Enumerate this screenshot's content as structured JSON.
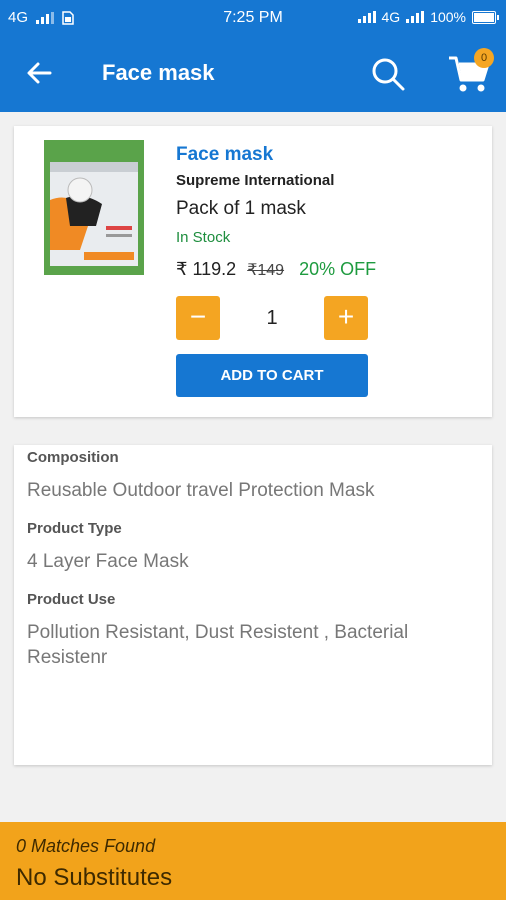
{
  "status_bar": {
    "network_left": "4G",
    "time": "7:25 PM",
    "network_right": "4G",
    "battery": "100%"
  },
  "app_bar": {
    "title": "Face mask",
    "cart_count": "0",
    "back_icon": "arrow-left-icon",
    "search_icon": "search-icon",
    "cart_icon": "cart-icon"
  },
  "product": {
    "name": "Face mask",
    "manufacturer": "Supreme International",
    "pack": "Pack of 1 mask",
    "stock": "In Stock",
    "price": "₹ 119.2",
    "mrp": "₹149",
    "discount": "20% OFF",
    "quantity": "1",
    "minus": "−",
    "plus": "+",
    "add_to_cart": "ADD TO CART"
  },
  "details": [
    {
      "label": "Composition",
      "value": "Reusable Outdoor travel Protection Mask"
    },
    {
      "label": "Product Type",
      "value": "4 Layer Face Mask"
    },
    {
      "label": "Product Use",
      "value": "Pollution Resistant, Dust Resistent , Bacterial Resistenr"
    }
  ],
  "substitutes": {
    "matches": "0 Matches Found",
    "status": "No Substitutes"
  },
  "colors": {
    "primary": "#1677d2",
    "accent": "#f4a522",
    "in_stock": "#1e8e3e",
    "discount": "#1e9b3f"
  }
}
